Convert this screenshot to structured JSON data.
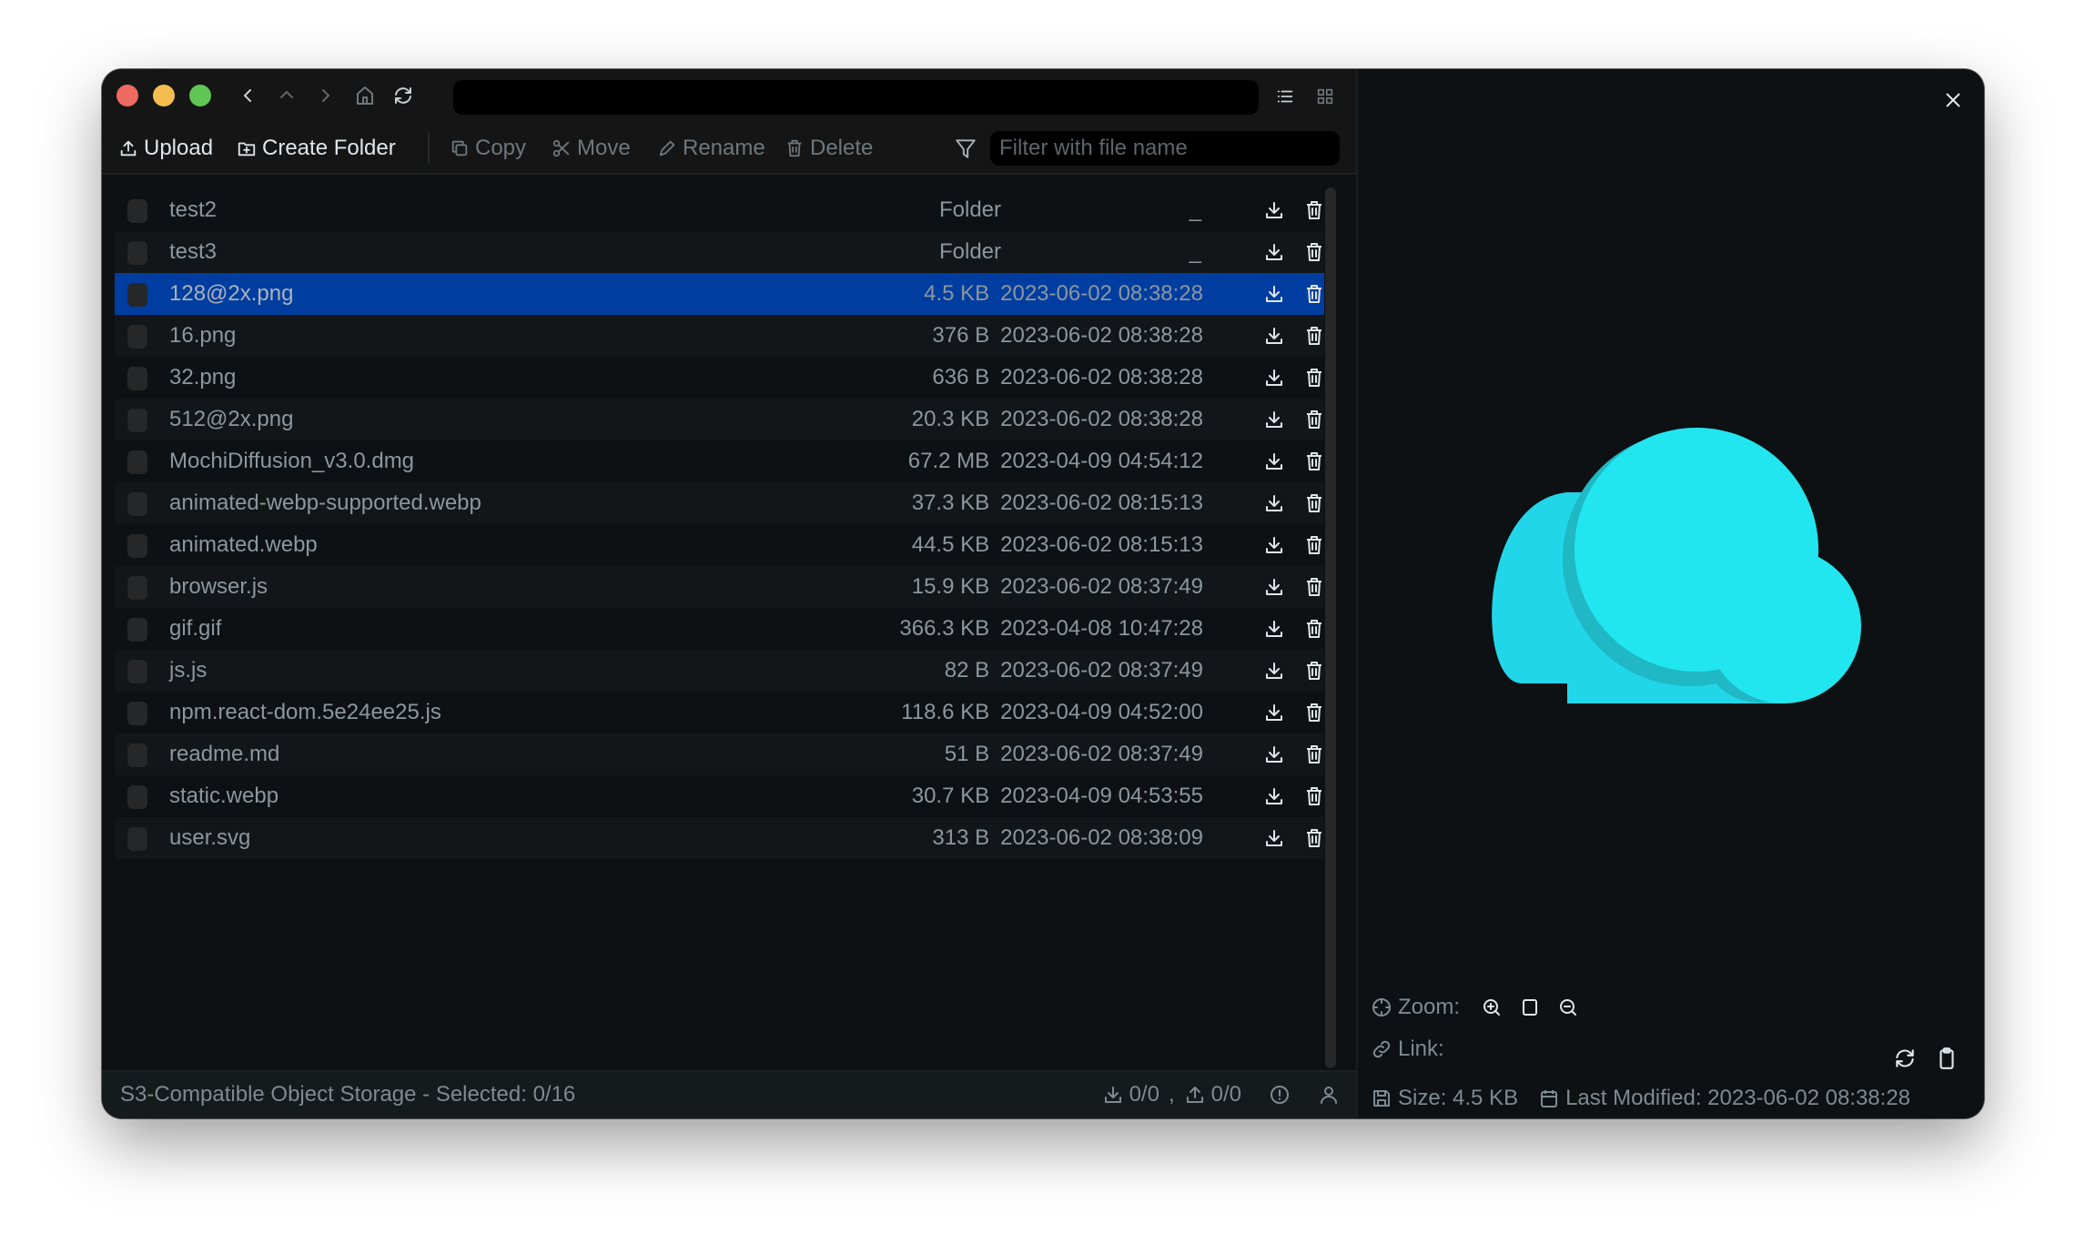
{
  "window": {
    "path": "",
    "nav": {
      "back": "chevron-left",
      "up": "chevron-up",
      "forward": "chevron-right",
      "home": "home",
      "refresh": "refresh"
    },
    "view_modes": [
      "list",
      "grid"
    ]
  },
  "toolbar": {
    "upload_label": "Upload",
    "create_folder_label": "Create Folder",
    "copy_label": "Copy",
    "move_label": "Move",
    "rename_label": "Rename",
    "delete_label": "Delete",
    "filter_placeholder": "Filter with file name",
    "filter_value": ""
  },
  "files": [
    {
      "name": "test2",
      "type": "Folder",
      "size": "",
      "modified": "_",
      "selected": false
    },
    {
      "name": "test3",
      "type": "Folder",
      "size": "",
      "modified": "_",
      "selected": false
    },
    {
      "name": "128@2x.png",
      "type": "file",
      "size": "4.5 KB",
      "modified": "2023-06-02 08:38:28",
      "selected": true
    },
    {
      "name": "16.png",
      "type": "file",
      "size": "376 B",
      "modified": "2023-06-02 08:38:28",
      "selected": false
    },
    {
      "name": "32.png",
      "type": "file",
      "size": "636 B",
      "modified": "2023-06-02 08:38:28",
      "selected": false
    },
    {
      "name": "512@2x.png",
      "type": "file",
      "size": "20.3 KB",
      "modified": "2023-06-02 08:38:28",
      "selected": false
    },
    {
      "name": "MochiDiffusion_v3.0.dmg",
      "type": "file",
      "size": "67.2 MB",
      "modified": "2023-04-09 04:54:12",
      "selected": false
    },
    {
      "name": "animated-webp-supported.webp",
      "type": "file",
      "size": "37.3 KB",
      "modified": "2023-06-02 08:15:13",
      "selected": false
    },
    {
      "name": "animated.webp",
      "type": "file",
      "size": "44.5 KB",
      "modified": "2023-06-02 08:15:13",
      "selected": false
    },
    {
      "name": "browser.js",
      "type": "file",
      "size": "15.9 KB",
      "modified": "2023-06-02 08:37:49",
      "selected": false
    },
    {
      "name": "gif.gif",
      "type": "file",
      "size": "366.3 KB",
      "modified": "2023-04-08 10:47:28",
      "selected": false
    },
    {
      "name": "js.js",
      "type": "file",
      "size": "82 B",
      "modified": "2023-06-02 08:37:49",
      "selected": false
    },
    {
      "name": "npm.react-dom.5e24ee25.js",
      "type": "file",
      "size": "118.6 KB",
      "modified": "2023-04-09 04:52:00",
      "selected": false
    },
    {
      "name": "readme.md",
      "type": "file",
      "size": "51 B",
      "modified": "2023-06-02 08:37:49",
      "selected": false
    },
    {
      "name": "static.webp",
      "type": "file",
      "size": "30.7 KB",
      "modified": "2023-04-09 04:53:55",
      "selected": false
    },
    {
      "name": "user.svg",
      "type": "file",
      "size": "313 B",
      "modified": "2023-06-02 08:38:09",
      "selected": false
    }
  ],
  "status": {
    "text": "S3-Compatible Object Storage - Selected: 0/16",
    "downloads": "0/0",
    "separator": ",",
    "uploads": "0/0"
  },
  "preview": {
    "zoom_label": "Zoom:",
    "link_label": "Link:",
    "size_label": "Size: 4.5 KB",
    "modified_label": "Last Modified: 2023-06-02 08:38:28",
    "image_colors": {
      "front": "#22e6ef",
      "back": "#22d6ea",
      "shade": "#1fb8c4"
    }
  },
  "colors": {
    "selected_row": "#003da0",
    "window_bg": "#0e1113",
    "header_bg": "#151515"
  }
}
